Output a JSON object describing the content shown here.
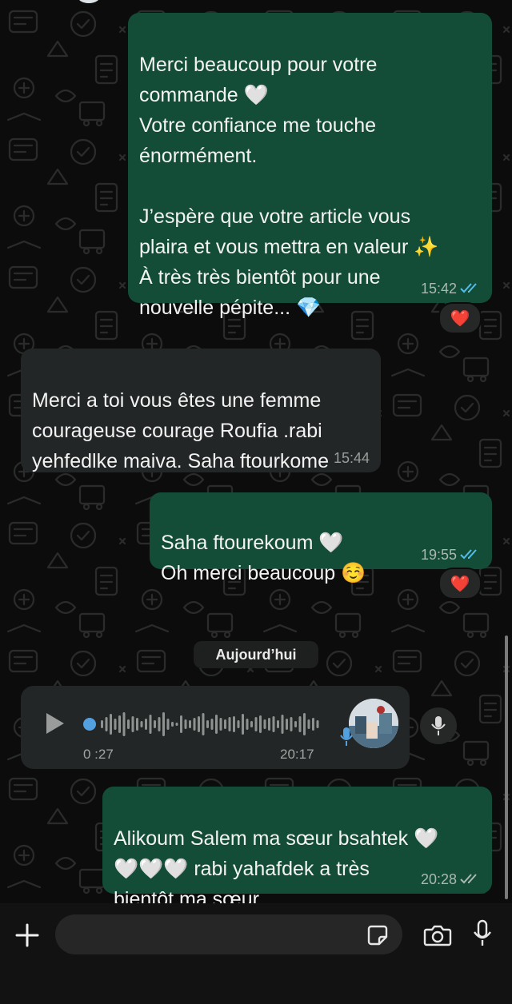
{
  "messages": [
    {
      "direction": "outgoing",
      "text": "Merci beaucoup pour votre\ncommande 🤍\nVotre confiance me touche\nénormément.\n\nJ’espère que votre article vous\nplaira et vous mettra en valeur ✨\nÀ très très bientôt pour une\nnouvelle pépite... 💎",
      "time": "15:42",
      "status": "read",
      "reaction": "❤️"
    },
    {
      "direction": "incoming",
      "text": "Merci a toi vous êtes une femme\ncourageuse courage Roufia .rabi\nyehfedlke maiva. Saha ftourkome",
      "time": "15:44"
    },
    {
      "direction": "outgoing",
      "text": "Saha ftourekoum 🤍\nOh merci beaucoup ☺️",
      "time": "19:55",
      "status": "read",
      "reaction": "❤️"
    },
    {
      "direction": "outgoing",
      "text": "Alikoum Salem ma sœur bsahtek 🤍\n🤍🤍🤍 rabi yahafdek a très\nbientôt ma sœur",
      "time": "20:28",
      "status": "delivered"
    }
  ],
  "date_divider": "Aujourd’hui",
  "voice_note": {
    "duration": "0 :27",
    "time": "20:17",
    "progress": 0
  },
  "composer": {
    "placeholder": ""
  },
  "icons": {
    "add": "plus-icon",
    "sticker": "sticker-icon",
    "camera": "camera-icon",
    "mic": "microphone-icon",
    "play": "play-icon"
  },
  "colors": {
    "outgoing_bubble": "#144d37",
    "incoming_bubble": "#232626",
    "read_ticks": "#53bdeb",
    "reaction_heart": "#e0112b"
  }
}
